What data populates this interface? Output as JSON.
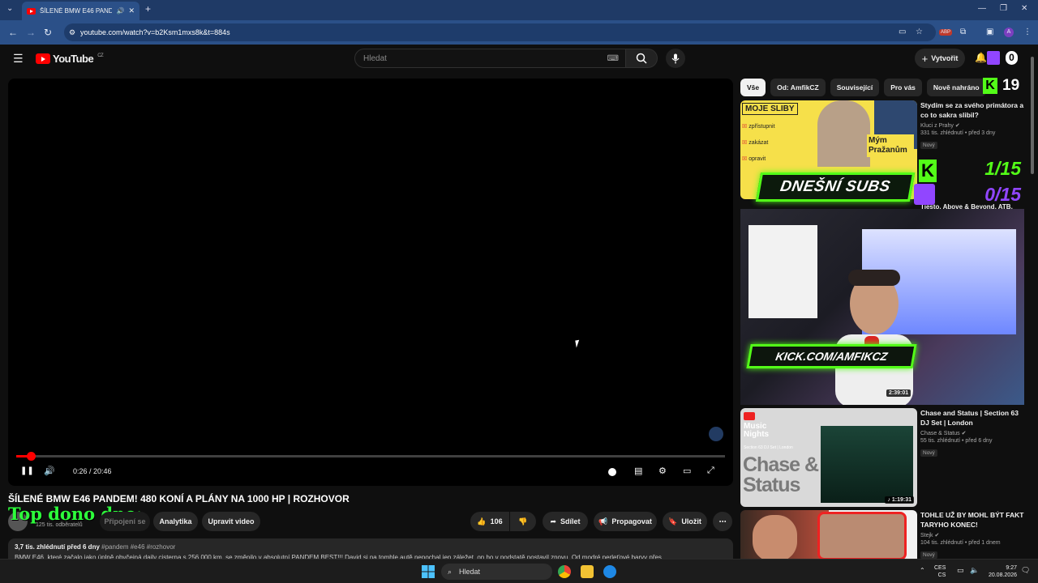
{
  "browser": {
    "tab_title": "ŠÍLENÉ BMW E46 PANDEM!",
    "new_tab_icon": "+",
    "url": "youtube.com/watch?v=b2Ksm1mxs8k&t=884s"
  },
  "youtube": {
    "logo_text": "YouTube",
    "country": "CZ",
    "search_placeholder": "Hledat",
    "create_label": "Vytvořit"
  },
  "player": {
    "time_display": "0:26 / 20:46",
    "progress_fraction": 0.021
  },
  "video": {
    "title": "ŠÍLENÉ BMW E46 PANDEM! 480 KONÍ A PLÁNY NA 1000 HP | ROZHOVOR",
    "overlay_text": "Top dono dne:",
    "subscribers": "125 tis. odběratelů",
    "buttons": {
      "connect": "Připojení se",
      "analytics": "Analytika",
      "edit": "Upravit video",
      "likes": "106",
      "share": "Sdílet",
      "promote": "Propagovat",
      "save": "Uložit"
    },
    "views_date": "3,7 tis. zhlédnutí  před 6 dny",
    "tags": "#pandem #e46 #rozhovor",
    "description": "BMW E46, které začalo jako úplně obyčejná daily cisterna s 256 000 km, se změnilo v absolutní PANDEM BEST!!! David si na tomhle autě nepochal jen záležet, on ho v podstatě postavil znovu. Od modré perleťové barvy přes..."
  },
  "chips": [
    "Vše",
    "Od: AmfikCZ",
    "Související",
    "Pro vás",
    "Nově nahráno"
  ],
  "recommendations": [
    {
      "title": "Stydím se za svého primátora a co to sakra slibil?",
      "channel": "Kluci z Prahy",
      "meta": "331 tis. zhlédnutí • před 3 dny",
      "badge": "Nový",
      "thumb_text": "MOJE SLIBY",
      "thumb_items": [
        "zpřístupnit",
        "zakázat",
        "opravit"
      ],
      "thumb_caption": "Mým Pražanům"
    },
    {
      "title": "Tiesto, Above & Beyond, ATB, Armin van Buuren, Aly & Fila, 4...",
      "duration": "2:39:01"
    },
    {
      "title": "Chase and Status | Section 63 DJ Set | London",
      "channel": "Chase & Status",
      "meta": "55 tis. zhlédnutí • před 6 dny",
      "badge": "Nový",
      "duration": "1:19:31",
      "thumb_brand": "Music Nights",
      "thumb_sub": "Section 63 DJ Set | London",
      "thumb_big": "Chase & Status"
    },
    {
      "title": "TOHLE UŽ BY MOHL BÝT FAKT TARYHO KONEC!",
      "channel": "Stejk",
      "meta": "104 tis. zhlédnutí • před 1 dnem",
      "badge": "Nový"
    }
  ],
  "stream_overlay": {
    "subs_label": "DNEŠNÍ SUBS",
    "kick_count": "1/15",
    "twitch_count": "0/15",
    "kick_url": "KICK.COM/AMFIKCZ",
    "viewer_count": "19",
    "notif_count": "0"
  },
  "taskbar": {
    "search_label": "Hledat",
    "lang_top": "CES",
    "lang_bottom": "CS",
    "time": "9:27",
    "date": "20.08.2026"
  },
  "colors": {
    "accent_red": "#ff0000",
    "kick_green": "#53fc18",
    "twitch_purple": "#9146ff",
    "overlay_green": "#2dff3b"
  }
}
